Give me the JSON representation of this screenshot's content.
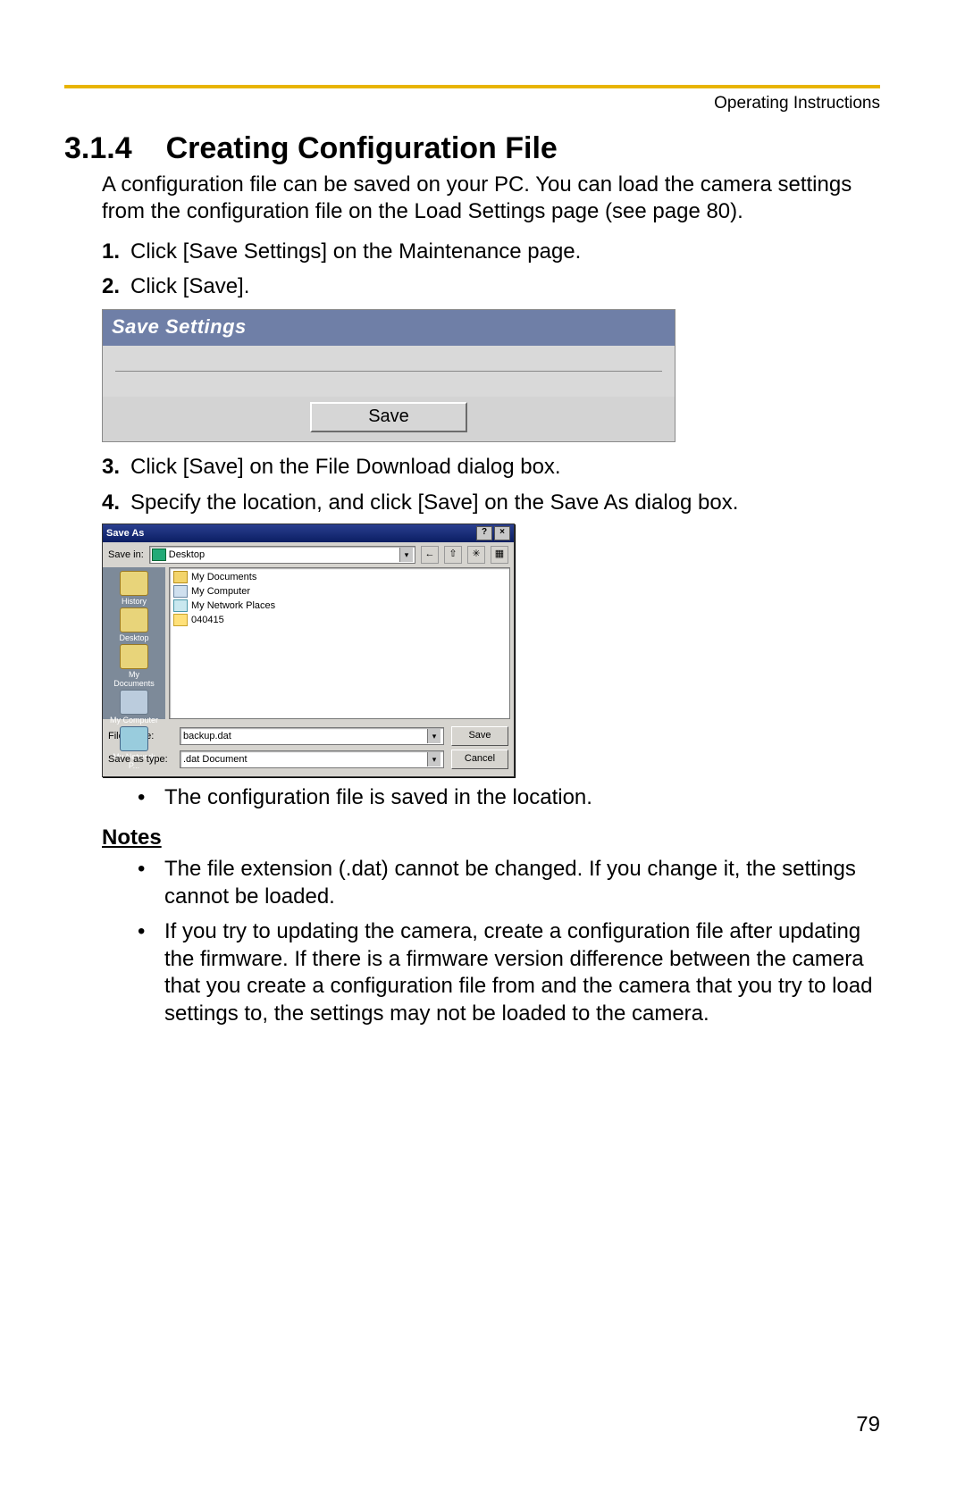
{
  "running_head": "Operating Instructions",
  "section_number": "3.1.4",
  "section_title": "Creating Configuration File",
  "intro": "A configuration file can be saved on your PC. You can load the camera settings from the configuration file on the Load Settings page (see page 80).",
  "steps": {
    "s1": "Click [Save Settings] on the Maintenance page.",
    "s2": "Click [Save].",
    "s3": "Click [Save] on the File Download dialog box.",
    "s4": "Specify the location, and click [Save] on the Save As dialog box."
  },
  "save_settings_panel": {
    "title": "Save Settings",
    "button": "Save"
  },
  "saveas_dialog": {
    "title": "Save As",
    "help_btn": "?",
    "close_btn": "×",
    "savein_label": "Save in:",
    "savein_value": "Desktop",
    "tool_back": "←",
    "tool_up": "⇧",
    "tool_new": "✳",
    "tool_view": "▦",
    "side": {
      "history": "History",
      "desktop": "Desktop",
      "mydocs": "My Documents",
      "mycomp": "My Computer",
      "mynet": "My Network P..."
    },
    "list": {
      "i1": "My Documents",
      "i2": "My Computer",
      "i3": "My Network Places",
      "i4": "040415"
    },
    "filename_label": "File name:",
    "filename_value": "backup.dat",
    "savetype_label": "Save as type:",
    "savetype_value": ".dat Document",
    "save_btn": "Save",
    "cancel_btn": "Cancel"
  },
  "after_dialog_bullet": "The configuration file is saved in the location.",
  "notes_heading": "Notes",
  "notes": {
    "n1": "The file extension (.dat) cannot be changed. If you change it, the settings cannot be loaded.",
    "n2": "If you try to updating the camera, create a configuration file after updating the firmware. If there is a firmware version difference between the camera that you create a configuration file from and the camera that you try to load settings to, the settings may not be loaded to the camera."
  },
  "page_number": "79"
}
